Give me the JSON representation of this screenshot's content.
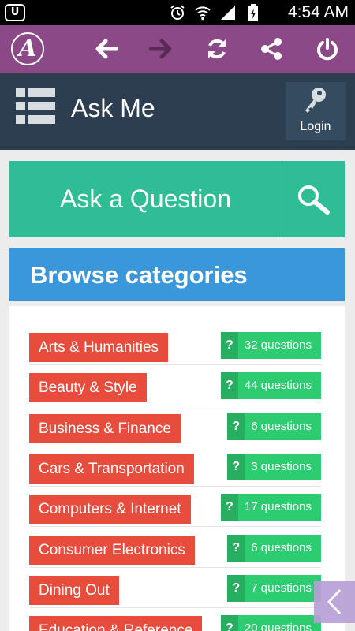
{
  "status_bar": {
    "left_icon": "u-app-icon",
    "left_text": "U",
    "icons": [
      "alarm-icon",
      "wifi-icon",
      "signal-icon",
      "battery-icon"
    ],
    "time": "4:54 AM"
  },
  "toolbar": {
    "logo_text": "A",
    "buttons": [
      "back-arrow-icon",
      "forward-arrow-icon",
      "refresh-icon",
      "share-icon",
      "power-icon"
    ],
    "color": "#8b4a87"
  },
  "header": {
    "title": "Ask Me",
    "login_label": "Login",
    "color": "#2c3e50"
  },
  "ask": {
    "label": "Ask a Question",
    "color": "#2ebd95"
  },
  "browse": {
    "title": "Browse categories",
    "color": "#3a97d9"
  },
  "categories": [
    {
      "name": "Arts & Humanities",
      "count": "32 questions"
    },
    {
      "name": "Beauty & Style",
      "count": "44 questions"
    },
    {
      "name": "Business & Finance",
      "count": "6 questions"
    },
    {
      "name": "Cars & Transportation",
      "count": "3 questions"
    },
    {
      "name": "Computers & Internet",
      "count": "17 questions"
    },
    {
      "name": "Consumer Electronics",
      "count": "6 questions"
    },
    {
      "name": "Dining Out",
      "count": "7 questions"
    },
    {
      "name": "Education & Reference",
      "count": "20 questions"
    }
  ],
  "badge_icon_text": "?",
  "colors": {
    "category_red": "#e74c3c",
    "count_green": "#2ecc71",
    "count_green_dark": "#27ae60"
  }
}
